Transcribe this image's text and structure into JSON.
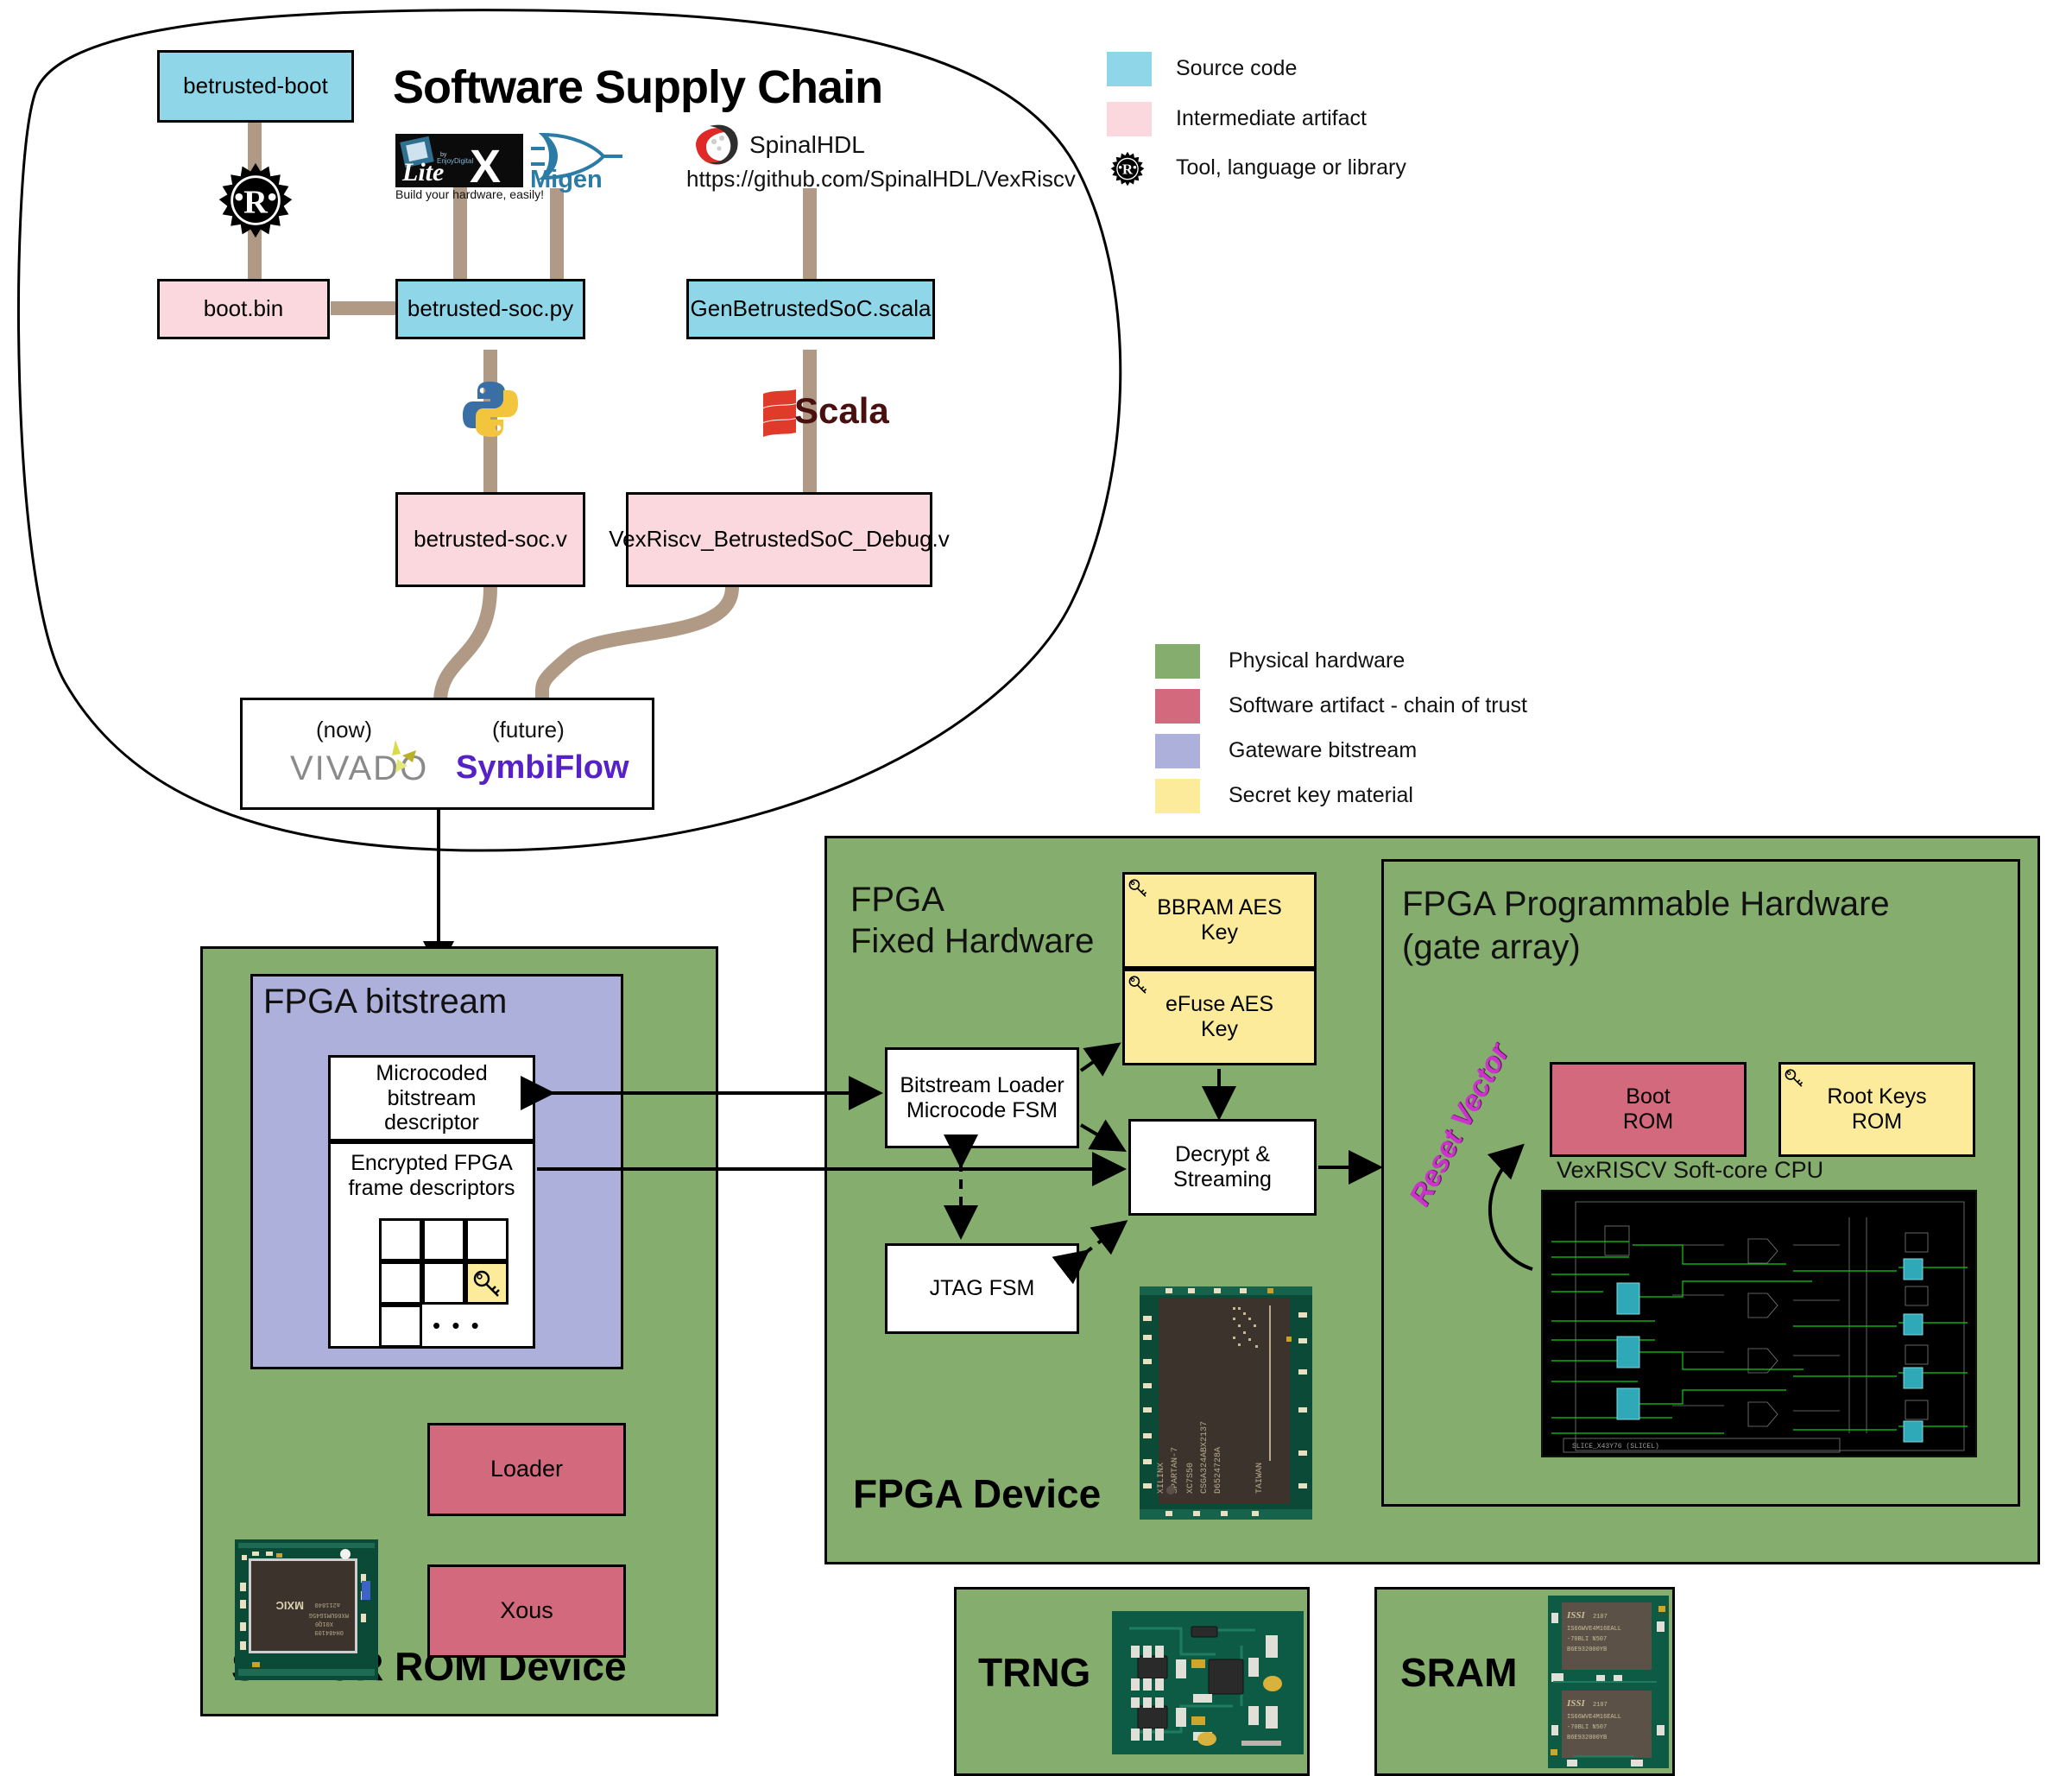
{
  "title": "Software Supply Chain",
  "legend_top": {
    "items": [
      {
        "label": "Source code",
        "color": "#8fd7e8",
        "kind": "swatch"
      },
      {
        "label": "Intermediate artifact",
        "color": "#fbd8de",
        "kind": "swatch"
      },
      {
        "label": "Tool, language or library",
        "color": "#000000",
        "kind": "rust-icon"
      }
    ]
  },
  "legend_bottom": {
    "items": [
      {
        "label": "Physical hardware",
        "color": "#85ad6e"
      },
      {
        "label": "Software artifact - chain of trust",
        "color": "#d2697c"
      },
      {
        "label": "Gateware bitstream",
        "color": "#aeb0dc"
      },
      {
        "label": " Secret key material",
        "color": "#fbeb9b"
      }
    ]
  },
  "supply_chain": {
    "betrusted_boot": "betrusted-boot",
    "boot_bin": "boot.bin",
    "betrusted_soc_py": "betrusted-soc.py",
    "gen_betrusted_soc_scala": "GenBetrustedSoC.scala",
    "betrusted_soc_v": "betrusted-soc.v",
    "vexriscv_debug_v": "VexRiscv_BetrustedSoC_Debug.v",
    "tools": {
      "rust": "Rust",
      "litex": "LiteX",
      "litex_tagline": "Build your hardware, easily!",
      "migen": "Migen",
      "spinalhdl": "SpinalHDL",
      "spinalhdl_url": "https://github.com/SpinalHDL/VexRiscv",
      "python": "Python",
      "scala": "Scala"
    },
    "synth_box": {
      "now_label": "(now)",
      "future_label": "(future)",
      "now_tool": "VIVADO",
      "future_tool": "SymbiFlow"
    }
  },
  "spinor": {
    "device_title": "SPINOR ROM Device",
    "bitstream_title": "FPGA bitstream",
    "microcoded_descriptor": "Microcoded\nbitstream\ndescriptor",
    "microcoded_descriptor_lines": [
      "Microcoded",
      "bitstream",
      "descriptor"
    ],
    "encrypted_frames": "Encrypted FPGA\nframe descriptors",
    "encrypted_frames_lines": [
      "Encrypted FPGA",
      "frame descriptors"
    ],
    "ellipsis": "• • •",
    "loader": "Loader",
    "xous": "Xous",
    "chip_photo_text": [
      "MXIC",
      "a211840",
      "MX66UM1G45G",
      "X01Q0",
      "0H484109"
    ]
  },
  "fpga_device": {
    "device_title": "FPGA Device",
    "fixed_hw_title_lines": [
      "FPGA",
      "Fixed Hardware"
    ],
    "prog_hw_title_lines": [
      "FPGA Programmable Hardware",
      "(gate array)"
    ],
    "bbram_key_lines": [
      "BBRAM AES",
      "Key"
    ],
    "efuse_key_lines": [
      "eFuse AES",
      "Key"
    ],
    "bitstream_loader_lines": [
      "Bitstream Loader",
      "Microcode FSM"
    ],
    "decrypt_lines": [
      "Decrypt &",
      "Streaming"
    ],
    "jtag_fsm": "JTAG FSM",
    "boot_rom_lines": [
      "Boot",
      "ROM"
    ],
    "root_keys_lines": [
      "Root Keys",
      "ROM"
    ],
    "reset_vector": "Reset Vector",
    "cpu_caption": "VexRISCV Soft-core CPU",
    "cpu_schematic_label": "SLICE_X43Y76 (SLICEL)",
    "fpga_chip_text": [
      "XILINX",
      "SPARTAN-7",
      "XC7S50",
      "CSGA324ABX2137",
      "D6524728A",
      "TAIWAN"
    ]
  },
  "trng": {
    "title": "TRNG"
  },
  "sram": {
    "title": "SRAM",
    "chip_text": [
      "ISSI 2107",
      "IS66WVE4M16EALL",
      "-70BLI  N507",
      "B6E932000YB"
    ]
  }
}
